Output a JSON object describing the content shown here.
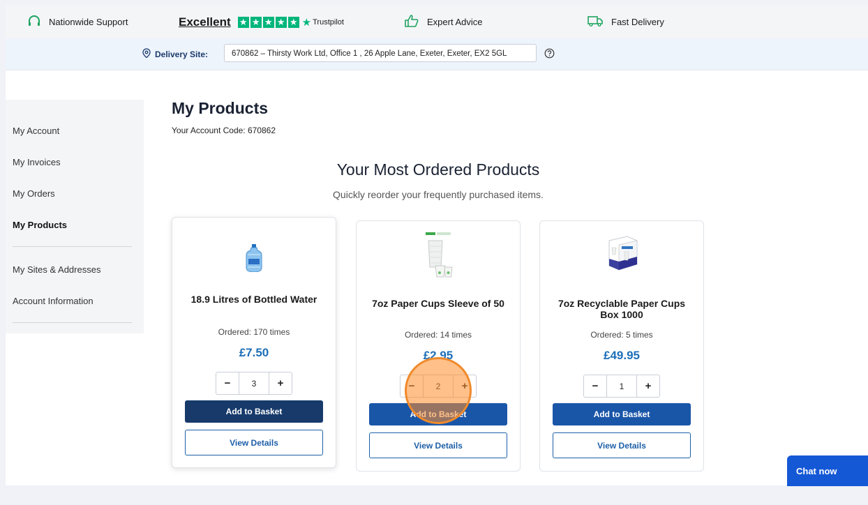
{
  "promo": {
    "support": "Nationwide Support",
    "rating_word": "Excellent",
    "trustpilot": "Trustpilot",
    "advice": "Expert Advice",
    "delivery": "Fast Delivery",
    "trustpilot_color": "#00b67a"
  },
  "delivery_site": {
    "label": "Delivery Site:",
    "value": "670862 – Thirsty Work Ltd, Office 1 , 26 Apple Lane, Exeter, Exeter, EX2 5GL"
  },
  "sidebar": {
    "items": [
      {
        "label": "My Account"
      },
      {
        "label": "My Invoices"
      },
      {
        "label": "My Orders"
      },
      {
        "label": "My Products",
        "active": true
      },
      {
        "label": "My Sites & Addresses"
      },
      {
        "label": "Account Information"
      }
    ]
  },
  "header": {
    "title": "My Products",
    "account_code": "Your Account Code: 670862"
  },
  "section": {
    "title": "Your Most Ordered Products",
    "subtitle": "Quickly reorder your frequently purchased items."
  },
  "products": [
    {
      "name": "18.9 Litres of Bottled Water",
      "ordered": "Ordered: 170 times",
      "price": "£7.50",
      "qty": "3",
      "add": "Add to Basket",
      "details": "View Details",
      "image": "water-bottle-icon"
    },
    {
      "name": "7oz Paper Cups Sleeve of 50",
      "ordered": "Ordered: 14 times",
      "price": "£2.95",
      "qty": "2",
      "add": "Add to Basket",
      "details": "View Details",
      "image": "paper-cups-icon"
    },
    {
      "name": "7oz Recyclable Paper Cups Box 1000",
      "ordered": "Ordered: 5 times",
      "price": "£49.95",
      "qty": "1",
      "add": "Add to Basket",
      "details": "View Details",
      "image": "cup-box-icon"
    }
  ],
  "qty_controls": {
    "minus": "−",
    "plus": "+"
  },
  "chat": {
    "label": "Chat now"
  },
  "colors": {
    "price": "#1d6fb8",
    "basket_dark": "#173a6b",
    "basket": "#1a56a8",
    "chat": "#1558d6",
    "click_marker": "#f08a2c"
  }
}
